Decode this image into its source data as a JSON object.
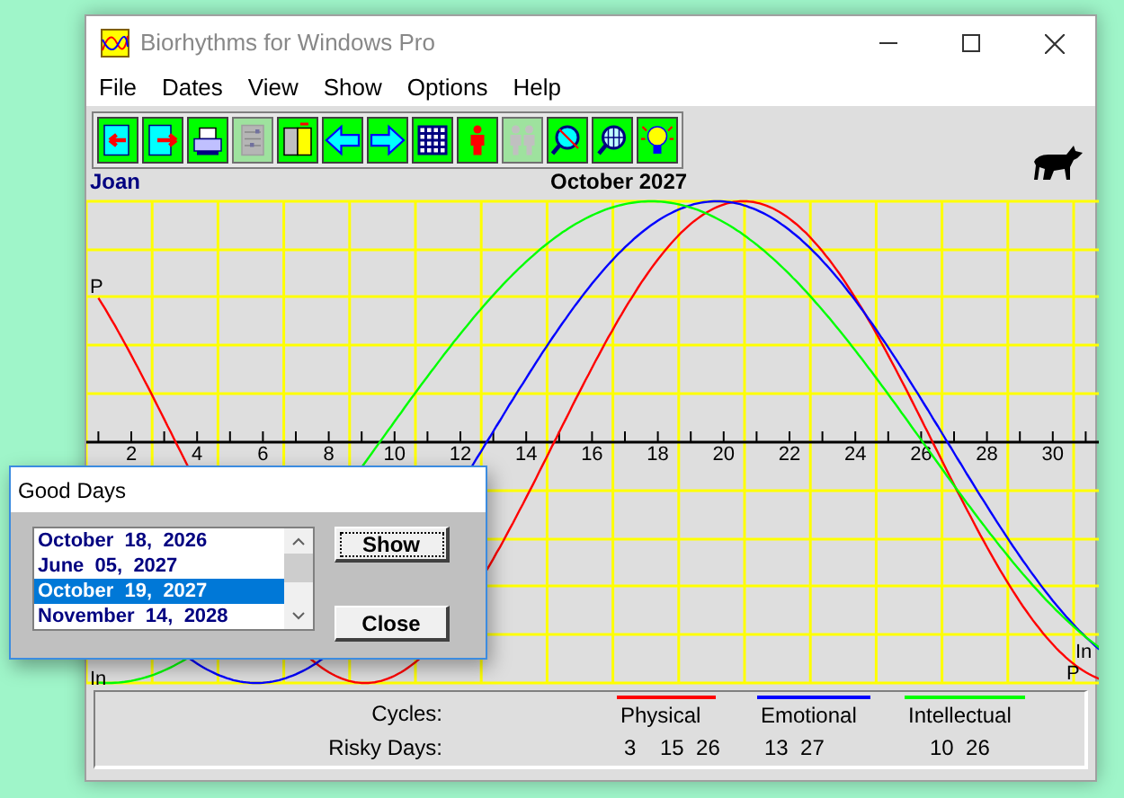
{
  "window": {
    "title": "Biorhythms for Windows Pro"
  },
  "menu": [
    "File",
    "Dates",
    "View",
    "Show",
    "Options",
    "Help"
  ],
  "toolbar": [
    {
      "disabled": false
    },
    {
      "disabled": false
    },
    {
      "disabled": false
    },
    {
      "disabled": true
    },
    {
      "disabled": false
    },
    {
      "disabled": false
    },
    {
      "disabled": false
    },
    {
      "disabled": false
    },
    {
      "disabled": false
    },
    {
      "disabled": true
    },
    {
      "disabled": false
    },
    {
      "disabled": false
    },
    {
      "disabled": false
    }
  ],
  "person": "Joan",
  "month": "October 2027",
  "chart": {
    "day_labels": [
      "2",
      "4",
      "6",
      "8",
      "10",
      "12",
      "14",
      "16",
      "18",
      "20",
      "22",
      "24",
      "26",
      "28",
      "30"
    ],
    "start_labels": [
      {
        "text": "P",
        "kind": "top"
      },
      {
        "text": "In",
        "kind": "bottom"
      }
    ],
    "end_labels": [
      {
        "text": "In",
        "kind": "middle"
      },
      {
        "text": "P",
        "kind": "bottom"
      }
    ]
  },
  "dialog": {
    "title": "Good Days",
    "dates": [
      {
        "text": "October  18,  2026",
        "selected": false
      },
      {
        "text": "June  05,  2027",
        "selected": false
      },
      {
        "text": "October  19,  2027",
        "selected": true
      },
      {
        "text": "November  14,  2028",
        "selected": false
      }
    ],
    "buttons": [
      {
        "label": "Show",
        "default": true
      },
      {
        "label": "Close",
        "default": false
      }
    ]
  },
  "legend": {
    "cycles_label": "Cycles:",
    "risky_label": "Risky Days:",
    "cycles": [
      {
        "name": "Physical",
        "color": "#ff0000",
        "risky_days": "3    15  26"
      },
      {
        "name": "Emotional",
        "color": "#0000ff",
        "risky_days": "13  27"
      },
      {
        "name": "Intellectual",
        "color": "#00ff00",
        "risky_days": "10  26"
      }
    ]
  }
}
